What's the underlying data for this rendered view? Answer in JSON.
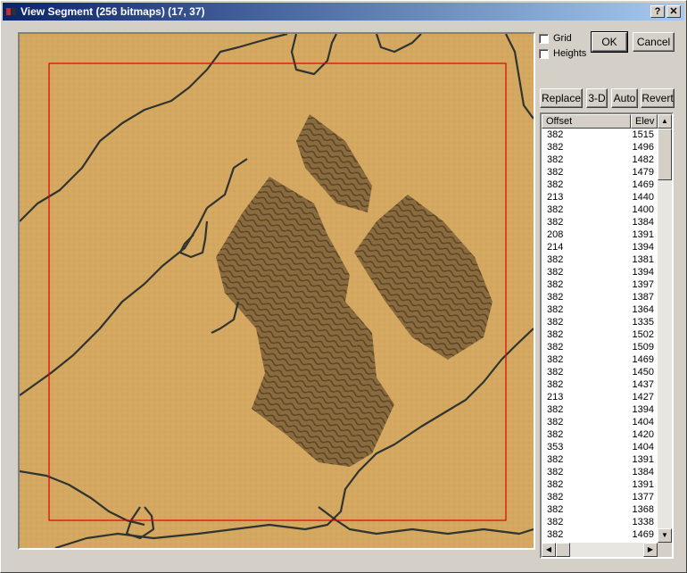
{
  "window": {
    "title": "View Segment (256 bitmaps) (17, 37)",
    "help_label": "?",
    "close_label": "✕"
  },
  "options": {
    "grid_label": "Grid",
    "grid_checked": false,
    "heights_label": "Heights",
    "heights_checked": false
  },
  "buttons": {
    "ok": "OK",
    "cancel": "Cancel",
    "replace": "Replace",
    "threed": "3-D",
    "auto": "Auto",
    "revert": "Revert"
  },
  "list": {
    "columns": [
      "Offset",
      "Elev"
    ],
    "rows": [
      [
        "382",
        "1515"
      ],
      [
        "382",
        "1496"
      ],
      [
        "382",
        "1482"
      ],
      [
        "382",
        "1479"
      ],
      [
        "382",
        "1469"
      ],
      [
        "213",
        "1440"
      ],
      [
        "382",
        "1400"
      ],
      [
        "382",
        "1384"
      ],
      [
        "208",
        "1391"
      ],
      [
        "214",
        "1394"
      ],
      [
        "382",
        "1381"
      ],
      [
        "382",
        "1394"
      ],
      [
        "382",
        "1397"
      ],
      [
        "382",
        "1387"
      ],
      [
        "382",
        "1364"
      ],
      [
        "382",
        "1335"
      ],
      [
        "382",
        "1502"
      ],
      [
        "382",
        "1509"
      ],
      [
        "382",
        "1469"
      ],
      [
        "382",
        "1450"
      ],
      [
        "382",
        "1437"
      ],
      [
        "213",
        "1427"
      ],
      [
        "382",
        "1394"
      ],
      [
        "382",
        "1404"
      ],
      [
        "382",
        "1420"
      ],
      [
        "353",
        "1404"
      ],
      [
        "382",
        "1391"
      ],
      [
        "382",
        "1384"
      ],
      [
        "382",
        "1391"
      ],
      [
        "382",
        "1377"
      ],
      [
        "382",
        "1368"
      ],
      [
        "382",
        "1338"
      ],
      [
        "382",
        "1469"
      ]
    ]
  },
  "viewport": {
    "sand_color": "#d4a860",
    "dune_color": "#8c6a3c",
    "crack_color": "#2f3430",
    "selection_color": "#e00000"
  }
}
